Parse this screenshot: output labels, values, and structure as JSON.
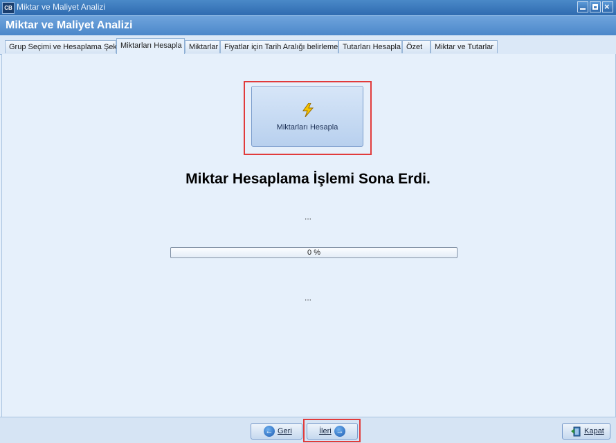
{
  "window": {
    "app_icon_text": "CB",
    "title": "Miktar ve Maliyet Analizi"
  },
  "header": {
    "title": "Miktar ve Maliyet Analizi"
  },
  "tabs": [
    {
      "label": "Grup Seçimi ve Hesaplama Şekli"
    },
    {
      "label": "Miktarları Hesapla"
    },
    {
      "label": "Miktarlar"
    },
    {
      "label": "Fiyatlar için Tarih Aralığı belirleme"
    },
    {
      "label": "Tutarları Hesapla"
    },
    {
      "label": "Özet"
    },
    {
      "label": "Miktar ve Tutarlar"
    }
  ],
  "active_tab": "Miktarları Hesapla",
  "main": {
    "calc_button_label": "Miktarları Hesapla",
    "calc_button_icon": "lightning-icon",
    "status_heading": "Miktar Hesaplama İşlemi Sona Erdi.",
    "status_line_1": "...",
    "progress_text": "0 %",
    "progress_value": 0,
    "status_line_2": "..."
  },
  "footer": {
    "back_label": "Geri",
    "next_label": "İleri",
    "close_label": "Kapat"
  },
  "colors": {
    "highlight": "#e13b3b",
    "title_bar": "#2f6bb0",
    "header": "#4a86c9",
    "content_bg": "#e6f0fb"
  }
}
